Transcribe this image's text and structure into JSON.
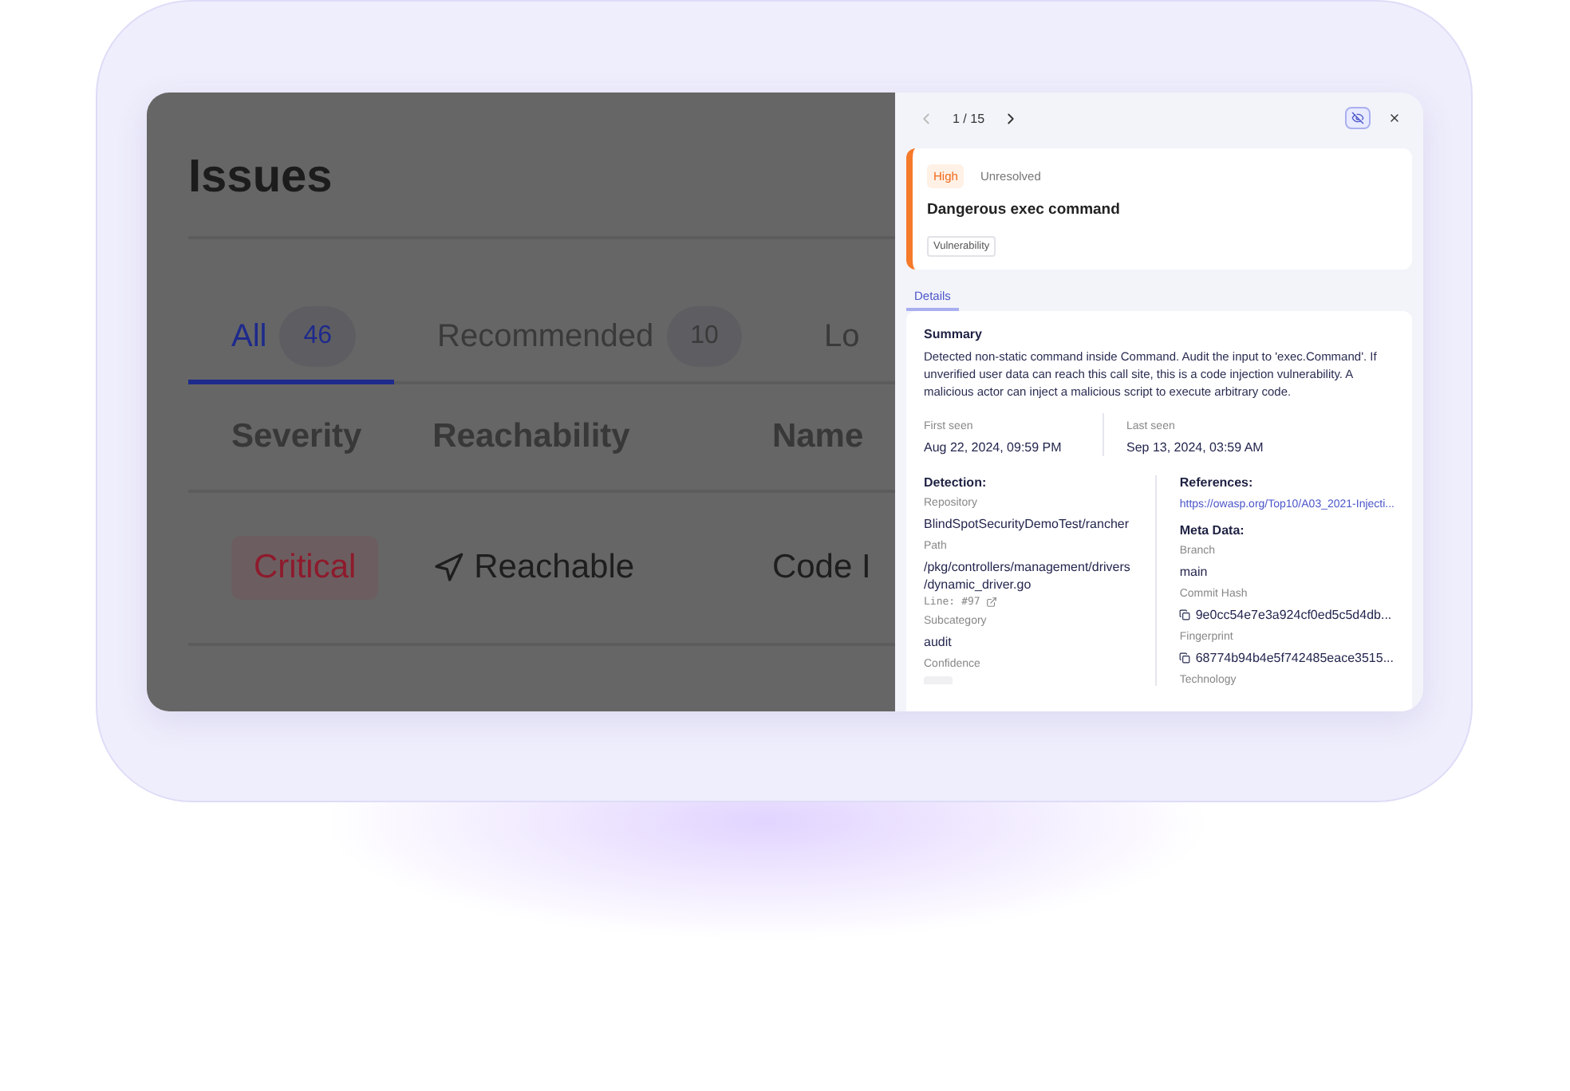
{
  "page": {
    "title": "Issues"
  },
  "tabs": [
    {
      "label": "All",
      "count": "46",
      "selected": true
    },
    {
      "label": "Recommended",
      "count": "10",
      "selected": false
    },
    {
      "label": "Lo",
      "selected": false
    }
  ],
  "table": {
    "columns": [
      "Severity",
      "Reachability",
      "Name"
    ],
    "rows": [
      {
        "severity": "Critical",
        "reachability": "Reachable",
        "name": "Code I"
      }
    ]
  },
  "drawer": {
    "pager": "1 / 15",
    "issue": {
      "severity": "High",
      "status": "Unresolved",
      "title": "Dangerous exec command",
      "tag": "Vulnerability"
    },
    "tabs": [
      {
        "label": "Details",
        "selected": true
      }
    ],
    "summary": {
      "heading": "Summary",
      "text": "Detected non-static command inside Command. Audit the input to 'exec.Command'. If unverified user data can reach this call site, this is a code injection vulnerability. A malicious actor can inject a malicious script to execute arbitrary code."
    },
    "seen": [
      {
        "label": "First seen",
        "value": "Aug 22, 2024, 09:59 PM"
      },
      {
        "label": "Last seen",
        "value": "Sep 13, 2024, 03:59 AM"
      }
    ],
    "detection": {
      "heading": "Detection:",
      "fields": [
        {
          "kind": "text",
          "label": "Repository",
          "value": "BlindSpotSecurityDemoTest/rancher"
        },
        {
          "kind": "path",
          "label": "Path",
          "value": "/pkg/controllers/management/drivers /dynamic_driver.go",
          "line_label": "Line:",
          "line": "#97"
        },
        {
          "kind": "text",
          "label": "Subcategory",
          "value": "audit"
        },
        {
          "kind": "badge",
          "label": "Confidence"
        }
      ]
    },
    "references": {
      "heading": "References:",
      "link": "https://owasp.org/Top10/A03_2021-Injecti..."
    },
    "meta": {
      "heading": "Meta Data:",
      "fields": [
        {
          "kind": "text",
          "label": "Branch",
          "value": "main"
        },
        {
          "kind": "hash",
          "label": "Commit Hash",
          "value": "9e0cc54e7e3a924cf0ed5c5d4db..."
        },
        {
          "kind": "hash",
          "label": "Fingerprint",
          "value": "68774b94b4e5f742485eace3515..."
        },
        {
          "kind": "label",
          "label": "Technology"
        }
      ]
    }
  }
}
